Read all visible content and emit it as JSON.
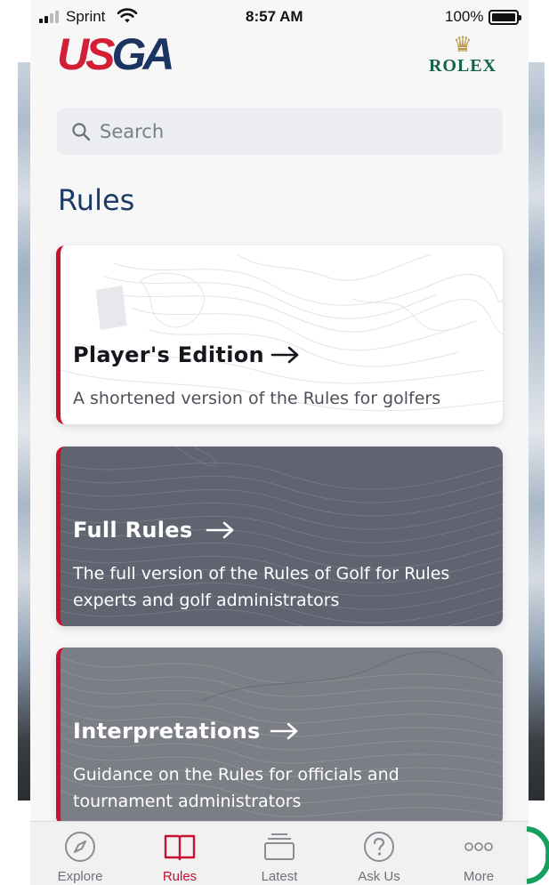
{
  "status_bar": {
    "carrier": "Sprint",
    "time": "8:57 AM",
    "battery": "100%"
  },
  "header": {
    "logo_us": "US",
    "logo_ga": "GA",
    "sponsor": "ROLEX"
  },
  "search": {
    "placeholder": "Search",
    "value": ""
  },
  "page": {
    "title": "Rules"
  },
  "cards": [
    {
      "title": "Player's Edition",
      "description": "A shortened version of the Rules for golfers",
      "theme": "light"
    },
    {
      "title": "Full Rules",
      "description": "The full version of the Rules of Golf for Rules experts and golf administrators",
      "theme": "dark"
    },
    {
      "title": "Interpretations",
      "description": "Guidance on the Rules for officials and tournament administrators",
      "theme": "grey"
    }
  ],
  "tab_bar": {
    "active": "Rules",
    "tabs": [
      {
        "label": "Explore",
        "icon": "compass-icon"
      },
      {
        "label": "Rules",
        "icon": "book-icon"
      },
      {
        "label": "Latest",
        "icon": "stack-icon"
      },
      {
        "label": "Ask Us",
        "icon": "question-icon"
      },
      {
        "label": "More",
        "icon": "more-icon"
      }
    ]
  },
  "colors": {
    "accent_red": "#c8102e",
    "title_navy": "#1c3a66",
    "rolex_green": "#126444"
  }
}
